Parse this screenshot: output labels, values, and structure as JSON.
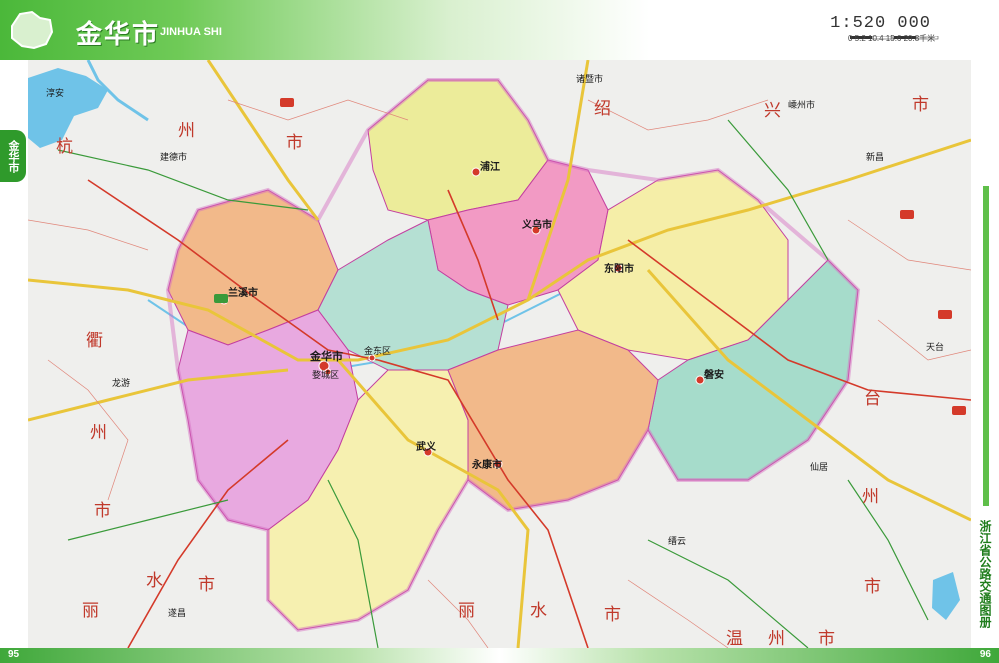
{
  "header": {
    "title_cn": "金华市",
    "title_en": "JINHUA SHI",
    "scale": "1:520 000",
    "scale_labels": "0    5.2  10.4  15.6  20.8千米"
  },
  "left_tab": "金华市",
  "right_tab": "浙江省公路交通图册",
  "page_left": "95",
  "page_right": "96",
  "colors": {
    "background": "#eeeeee",
    "water": "#6fc3e8",
    "boundary": "#c33fa0",
    "road_yellow": "#e9c53a",
    "road_red": "#d43a2a",
    "road_green": "#3a9a3a",
    "header_green": "#4bb83a"
  },
  "districts": [
    {
      "name": "兰溪市",
      "color": "#f2b98a"
    },
    {
      "name": "浦江县",
      "color": "#ecec9a"
    },
    {
      "name": "义乌市",
      "color": "#f29ac4"
    },
    {
      "name": "东阳市",
      "color": "#f5eea8"
    },
    {
      "name": "磐安县",
      "color": "#a6dccb"
    },
    {
      "name": "金东区",
      "color": "#b5e0d3"
    },
    {
      "name": "婺城区",
      "color": "#e8a9e0"
    },
    {
      "name": "武义县",
      "color": "#f6f0b0"
    },
    {
      "name": "永康市",
      "color": "#f2b98a"
    }
  ],
  "neighbor_labels": [
    {
      "text": "杭"
    },
    {
      "text": "州"
    },
    {
      "text": "市"
    },
    {
      "text": "绍"
    },
    {
      "text": "兴"
    },
    {
      "text": "市"
    },
    {
      "text": "衢"
    },
    {
      "text": "州"
    },
    {
      "text": "市"
    },
    {
      "text": "台"
    },
    {
      "text": "州"
    },
    {
      "text": "市"
    },
    {
      "text": "丽"
    },
    {
      "text": "水"
    },
    {
      "text": "市"
    },
    {
      "text": "丽"
    },
    {
      "text": "水"
    },
    {
      "text": "市"
    },
    {
      "text": "温"
    },
    {
      "text": "州"
    },
    {
      "text": "市"
    }
  ],
  "cities": [
    {
      "text": "金华市"
    },
    {
      "text": "兰溪市"
    },
    {
      "text": "浦江"
    },
    {
      "text": "义乌市"
    },
    {
      "text": "东阳市"
    },
    {
      "text": "磐安"
    },
    {
      "text": "武义"
    },
    {
      "text": "永康市"
    },
    {
      "text": "金东区"
    },
    {
      "text": "婺城区"
    },
    {
      "text": "建德市"
    },
    {
      "text": "淳安"
    },
    {
      "text": "嵊州市"
    },
    {
      "text": "新昌"
    },
    {
      "text": "天台"
    },
    {
      "text": "仙居"
    },
    {
      "text": "缙云"
    },
    {
      "text": "遂昌"
    },
    {
      "text": "龙游"
    },
    {
      "text": "诸暨市"
    }
  ]
}
